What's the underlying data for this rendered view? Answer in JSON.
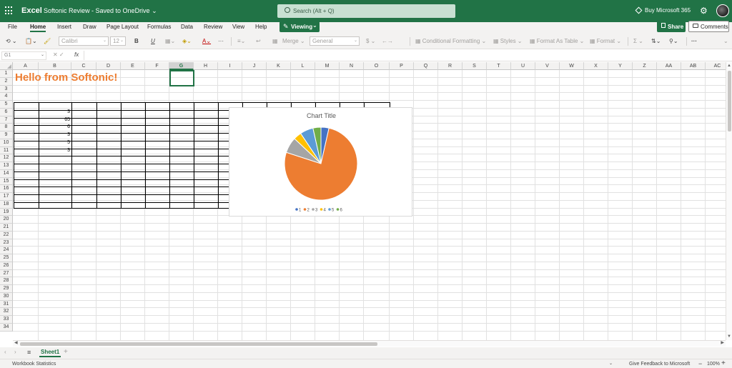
{
  "titlebar": {
    "app_name": "Excel",
    "document": "Softonic Review - Saved to OneDrive ⌄",
    "search_placeholder": "Search (Alt + Q)",
    "buy": "Buy Microsoft 365",
    "icons": [
      "app-launcher-icon",
      "search-icon",
      "diamond-icon",
      "gear-icon",
      "avatar"
    ]
  },
  "menu": {
    "items": [
      "File",
      "Home",
      "Insert",
      "Draw",
      "Page Layout",
      "Formulas",
      "Data",
      "Review",
      "View",
      "Help"
    ],
    "active": "Home",
    "viewing_label": "Viewing",
    "share_label": "Share",
    "comments_label": "Comments"
  },
  "ribbon": {
    "font_name": "Calibri",
    "font_size": "12",
    "merge_label": "Merge",
    "number_format": "General",
    "currency_symbol": "$",
    "conditional_formatting": "Conditional Formatting",
    "styles": "Styles",
    "format_as_table": "Format As Table",
    "format": "Format",
    "more": "···"
  },
  "formula_bar": {
    "name_box": "G1",
    "fx": "fx",
    "content": ""
  },
  "grid": {
    "columns": [
      "A",
      "B",
      "C",
      "D",
      "E",
      "F",
      "G",
      "H",
      "I",
      "J",
      "K",
      "L",
      "M",
      "N",
      "O",
      "P",
      "Q",
      "R",
      "S",
      "T",
      "U",
      "V",
      "W",
      "X",
      "Y",
      "Z",
      "AA",
      "AB",
      "AC"
    ],
    "selected_column": "G",
    "rows": [
      "1",
      "2",
      "3",
      "4",
      "5",
      "6",
      "7",
      "8",
      "9",
      "10",
      "11",
      "12",
      "13",
      "14",
      "15",
      "16",
      "17",
      "18",
      "19",
      "20",
      "21",
      "22",
      "23",
      "24",
      "25",
      "26",
      "27",
      "28",
      "29",
      "30",
      "31",
      "32",
      "33",
      "34"
    ],
    "a1_text": "Hello from Softonic!",
    "b_values": [
      {
        "row": 6,
        "value": "3"
      },
      {
        "row": 7,
        "value": "65"
      },
      {
        "row": 8,
        "value": "6"
      },
      {
        "row": 9,
        "value": "3"
      },
      {
        "row": 10,
        "value": "5"
      },
      {
        "row": 11,
        "value": "3"
      }
    ]
  },
  "chart_data": {
    "type": "pie",
    "title": "Chart Title",
    "categories": [
      "1",
      "2",
      "3",
      "4",
      "5",
      "6"
    ],
    "values": [
      3,
      65,
      6,
      3,
      5,
      3
    ],
    "colors": [
      "#4472c4",
      "#ed7d31",
      "#a5a5a5",
      "#ffc000",
      "#5b9bd5",
      "#70ad47"
    ],
    "legend_position": "bottom"
  },
  "colors": {
    "excel_green": "#217346",
    "accent_orange": "#ed7d31"
  },
  "sheets": {
    "tabs": [
      "Sheet1"
    ],
    "active": "Sheet1",
    "add_label": "+"
  },
  "status": {
    "workbook_statistics": "Workbook Statistics",
    "feedback": "Give Feedback to Microsoft",
    "zoom": "100%"
  }
}
